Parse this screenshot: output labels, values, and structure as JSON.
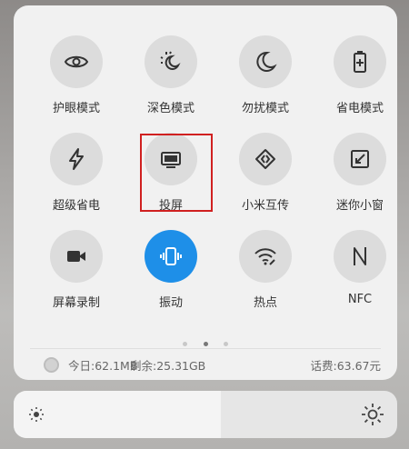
{
  "tiles": [
    {
      "label": "护眼模式",
      "icon": "eye-icon"
    },
    {
      "label": "深色模式",
      "icon": "sun-moon-icon"
    },
    {
      "label": "勿扰模式",
      "icon": "moon-icon"
    },
    {
      "label": "省电模式",
      "icon": "battery-icon"
    },
    {
      "label": "超级省电",
      "icon": "bolt-icon"
    },
    {
      "label": "投屏",
      "icon": "monitor-icon"
    },
    {
      "label": "小米互传",
      "icon": "share-icon"
    },
    {
      "label": "迷你小窗",
      "icon": "mini-window-icon"
    },
    {
      "label": "屏幕录制",
      "icon": "video-icon"
    },
    {
      "label": "振动",
      "icon": "vibrate-icon"
    },
    {
      "label": "热点",
      "icon": "hotspot-icon"
    },
    {
      "label": "NFC",
      "icon": "nfc-icon"
    }
  ],
  "page_indicator": {
    "pages": 3,
    "current": 2
  },
  "status": {
    "today": "今日:62.1MB",
    "remaining": "剩余:25.31GB",
    "fee": "话费:63.67元"
  },
  "brightness": {
    "level": 0.54
  },
  "colors": {
    "accent": "#1e8fe8",
    "highlight": "#d02020"
  }
}
